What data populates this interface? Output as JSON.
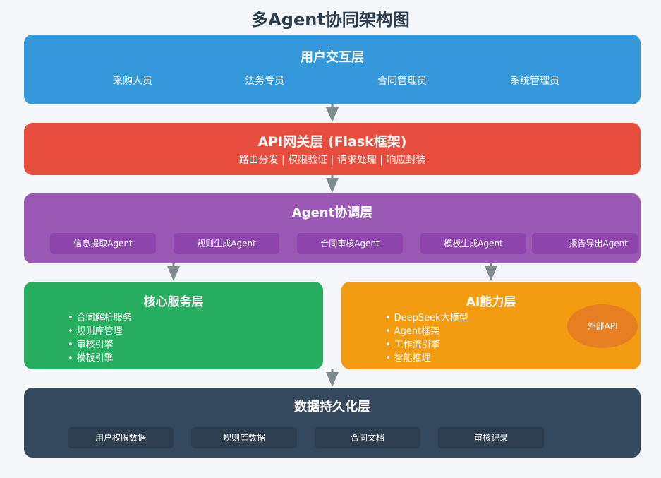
{
  "title": "多Agent协同架构图",
  "user_layer": {
    "title": "用户交互层",
    "roles": [
      "采购人员",
      "法务专员",
      "合同管理员",
      "系统管理员"
    ]
  },
  "api_layer": {
    "title": "API网关层 (Flask框架)",
    "subtitle": "路由分发 | 权限验证 | 请求处理 | 响应封装"
  },
  "agent_layer": {
    "title": "Agent协调层",
    "agents": [
      "信息提取Agent",
      "规则生成Agent",
      "合同审核Agent",
      "模板生成Agent",
      "报告导出Agent"
    ]
  },
  "core_layer": {
    "title": "核心服务层",
    "items": [
      "合同解析服务",
      "规则库管理",
      "审核引擎",
      "模板引擎"
    ]
  },
  "ai_layer": {
    "title": "AI能力层",
    "items": [
      "DeepSeek大模型",
      "Agent框架",
      "工作流引擎",
      "智能推理"
    ],
    "external": "外部API"
  },
  "data_layer": {
    "title": "数据持久化层",
    "stores": [
      "用户权限数据",
      "规则库数据",
      "合同文档",
      "审核记录"
    ]
  },
  "colors": {
    "user": "#3498db",
    "api": "#e74c3c",
    "agent": "#9b59b6",
    "core": "#27ae60",
    "ai": "#f39c12",
    "data": "#34495e",
    "arrow": "#7f8c8d"
  }
}
